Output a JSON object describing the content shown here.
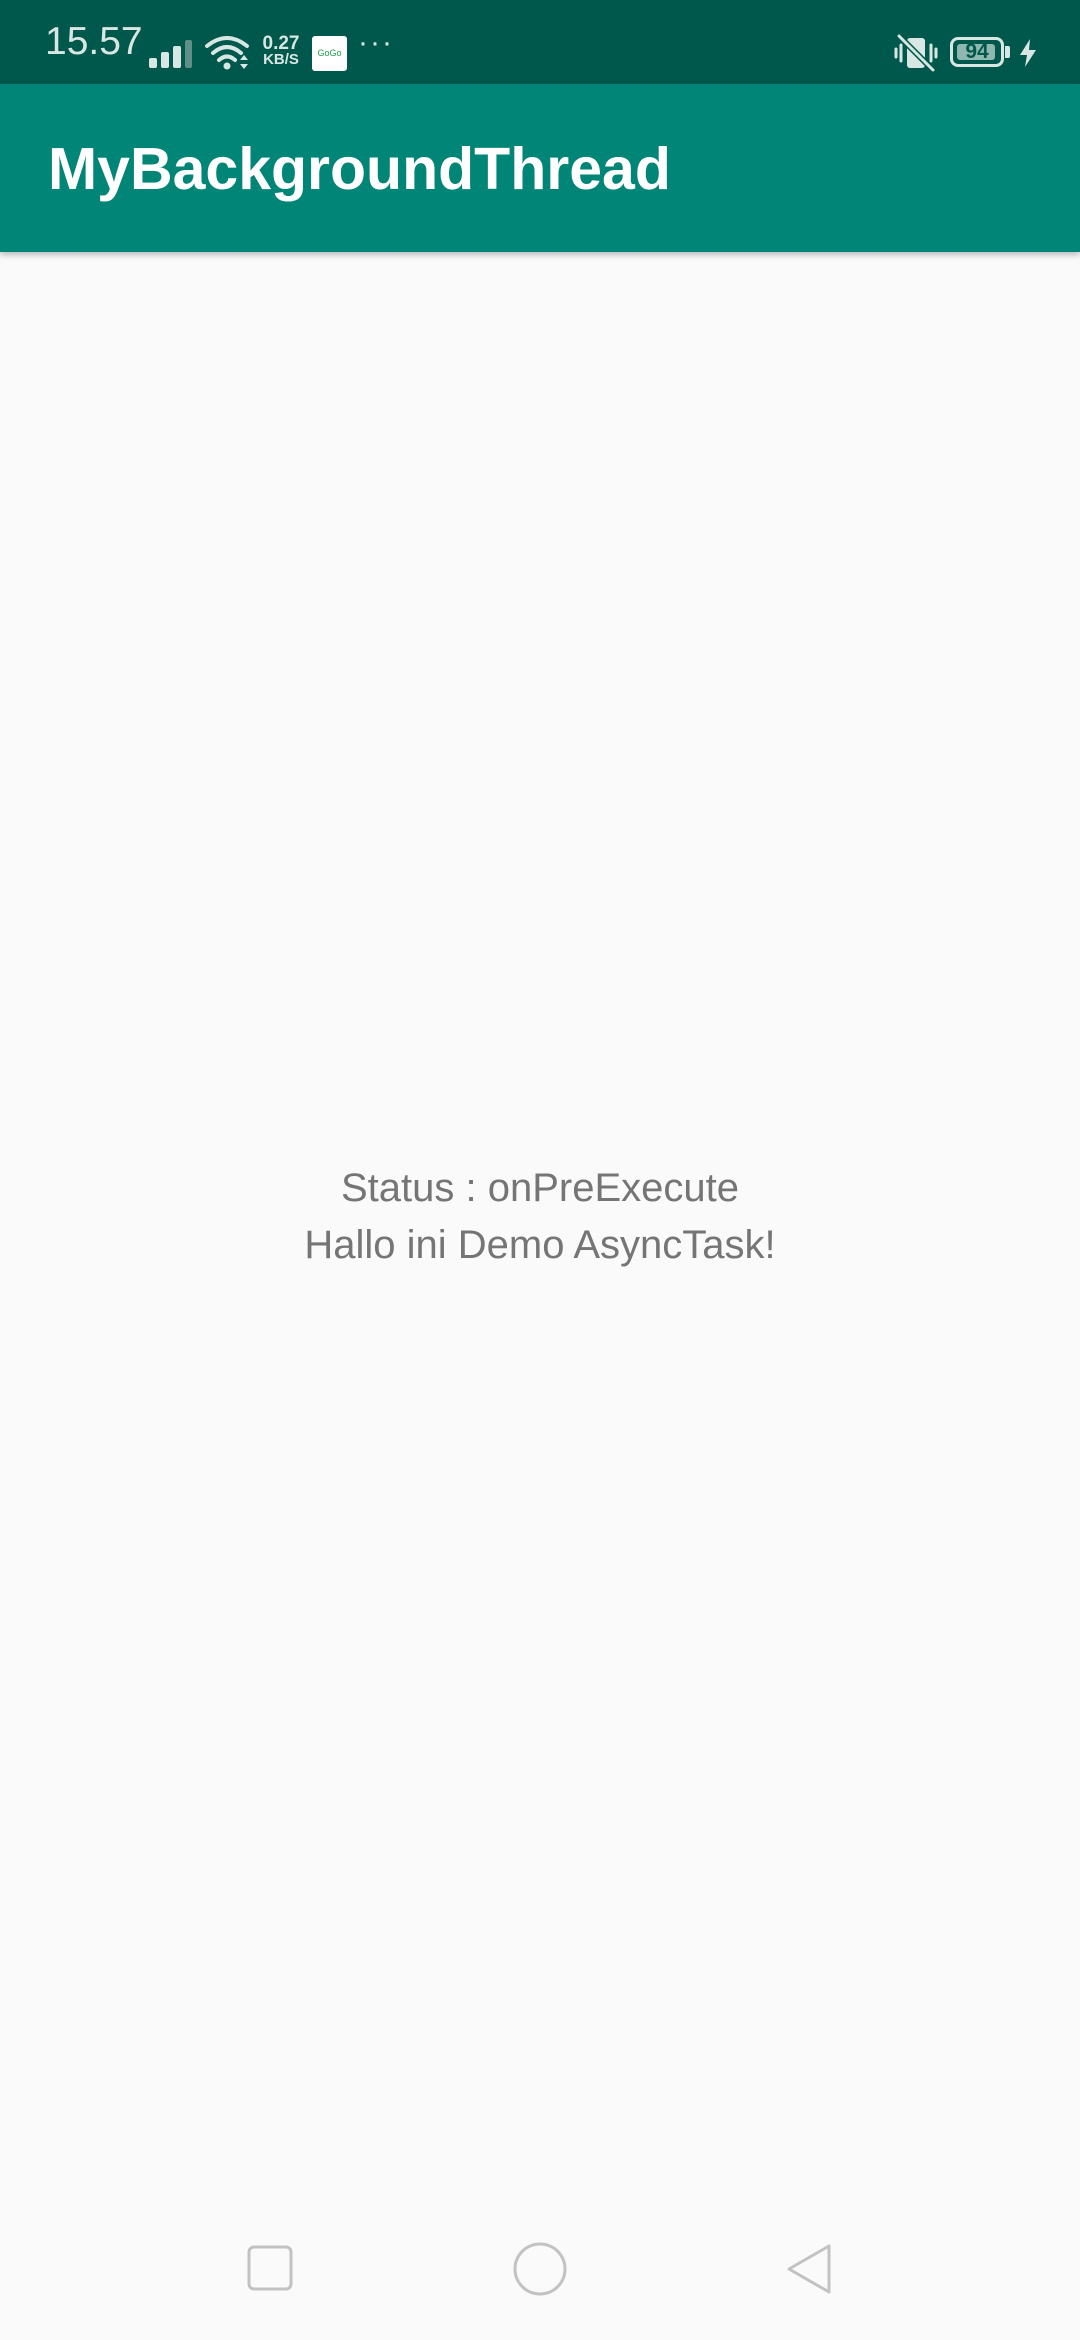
{
  "status_bar": {
    "time": "15.57",
    "net_speed_value": "0.27",
    "net_speed_unit": "KB/S",
    "notification_app_label": "GoGo",
    "more_indicator": "···",
    "battery_level": "94",
    "battery_fraction": 0.94,
    "icons": [
      "signal-icon",
      "wifi-icon",
      "vibrate-icon",
      "battery-icon",
      "charging-icon"
    ]
  },
  "app_bar": {
    "title": "MyBackgroundThread",
    "color": "#008577"
  },
  "content": {
    "status_line": "Status : onPreExecute",
    "message_line": "Hallo ini Demo AsyncTask!"
  },
  "nav_bar": {
    "buttons": [
      "recents",
      "home",
      "back"
    ]
  },
  "colors": {
    "status_bar": "#00574b",
    "app_bar": "#008577",
    "background": "#fafafa",
    "text_secondary": "#757575"
  }
}
